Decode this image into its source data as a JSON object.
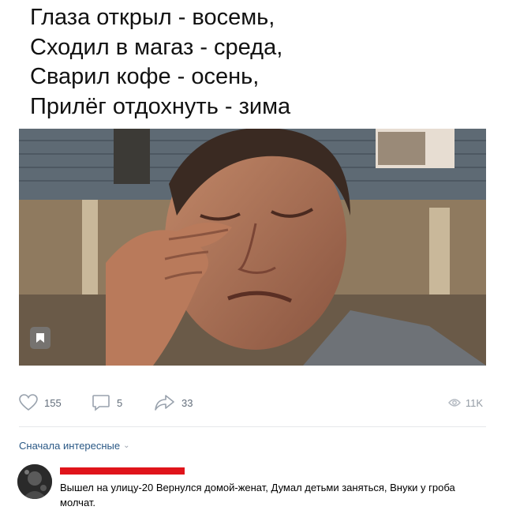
{
  "post": {
    "caption_lines": [
      "Глаза открыл - восемь,",
      "Сходил в магаз - среда,",
      "Сварил кофе - осень,",
      "Прилёг отдохнуть - зима"
    ],
    "image_icon": "bookmark-icon"
  },
  "actions": {
    "likes": "155",
    "comments": "5",
    "shares": "33",
    "views": "11K"
  },
  "comments_section": {
    "sort_label": "Сначала интересные"
  },
  "comment": {
    "text": "Вышел на улицу-20 Вернулся домой-женат, Думал детьми заняться, Внуки у гроба молчат."
  },
  "colors": {
    "link": "#2a5885",
    "icon": "#99a2ad",
    "redaction": "#e0141b"
  }
}
